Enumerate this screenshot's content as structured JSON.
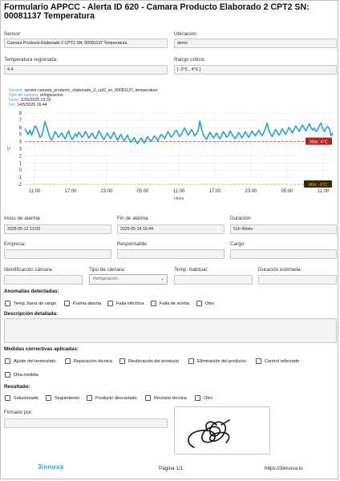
{
  "title": "Formulario APPCC - Alerta ID 620 - Camara Producto Elaborado 2 CPT2 SN: 00081137 Temperatura",
  "sensor": {
    "label": "Sensor:",
    "value": "Camara Producto Elaborado 2 CPT2 SN: 00081137 Temperatura"
  },
  "ubicacion": {
    "label": "Ubicación:",
    "value": "demo"
  },
  "temperatura": {
    "label": "Temperatura registrada:",
    "value": "4.4"
  },
  "rango": {
    "label": "Rango crítico:",
    "value": "[ -2°C , 4°C ]"
  },
  "chart_meta": {
    "sensor_key": "Sensor:",
    "sensor_val": "sensor.camara_producto_elaborado_2_cpt2_sn_00081137_temperature",
    "tipo_key": "Tipo de cámara:",
    "tipo_val": "refrigeracion",
    "inicio_key": "Inicio:",
    "inicio_val": "12/5/2025 13:03",
    "fin_key": "Fin:",
    "fin_val": "14/5/2025 16:44"
  },
  "chart_data": {
    "type": "line",
    "xlabel": "Hora",
    "ylabel": "°C",
    "ylim": [
      -2,
      8
    ],
    "yticks": [
      "8",
      "7",
      "6",
      "5",
      "4",
      "3",
      "2",
      "1",
      "0",
      "-1",
      "-2"
    ],
    "xticks": [
      "11:00",
      "17:00",
      "23:00",
      "05:00",
      "11:00",
      "17:00",
      "23:00",
      "05:00",
      "11:00"
    ],
    "max_label": "Máx: 4°C",
    "min_label": "Mín: -2°C",
    "thresholds": {
      "max": 4,
      "min": -2
    },
    "color": "#2a9fd8",
    "series": [
      {
        "values": [
          5.8,
          5.4,
          5.0,
          5.6,
          4.9,
          5.5,
          6.2,
          5.9,
          5.3,
          4.6,
          4.8,
          5.7,
          6.8,
          6.0,
          5.2,
          4.5,
          4.2,
          4.8,
          5.4,
          5.0,
          4.6,
          4.9,
          5.2,
          4.7,
          4.4,
          5.0,
          5.5,
          4.8,
          4.3,
          4.6,
          5.1,
          4.7,
          5.3,
          5.0,
          4.6,
          4.9,
          5.4,
          5.0,
          4.5,
          4.8,
          5.2,
          4.7,
          4.4,
          4.9,
          5.5,
          5.1,
          4.6,
          4.3,
          4.7,
          5.2,
          4.8,
          4.4,
          4.9,
          5.3,
          4.7,
          4.2,
          4.6,
          5.0,
          4.5,
          4.1,
          4.5,
          4.9,
          4.3,
          3.9,
          4.2,
          4.6,
          4.0,
          3.7,
          4.1,
          4.5,
          4.2,
          3.8,
          4.3,
          4.7,
          4.3,
          4.0,
          4.4,
          4.8,
          4.5,
          4.1,
          4.6,
          5.0,
          4.8,
          4.4,
          4.9,
          5.4,
          5.0,
          4.6,
          4.9,
          5.3,
          5.6,
          5.1,
          4.7,
          5.0,
          5.5,
          5.9,
          5.4,
          4.9,
          5.2,
          5.7,
          5.3,
          4.8,
          5.1,
          5.5,
          6.9,
          5.8,
          5.0,
          4.6,
          4.3,
          4.8,
          5.3,
          4.9,
          4.5,
          4.8,
          5.2,
          4.7,
          4.4,
          4.9,
          5.4,
          5.0,
          4.6,
          4.9,
          5.5,
          5.1,
          4.7,
          4.4,
          4.8,
          5.3,
          4.9,
          4.5,
          4.9,
          5.4,
          5.0,
          4.6,
          5.0,
          5.5,
          5.1,
          4.8,
          5.2,
          5.6,
          5.2,
          4.8,
          5.3,
          5.9,
          6.6,
          5.6,
          5.0,
          4.7,
          5.2,
          5.7,
          5.3,
          4.9,
          5.3,
          5.8,
          5.4,
          5.0,
          5.5,
          6.0,
          5.6,
          5.2,
          5.7,
          6.2,
          5.8,
          5.4,
          5.9,
          6.3,
          5.9,
          5.5,
          6.0,
          6.5,
          6.0,
          5.6,
          5.9,
          5.4,
          5.6,
          6.2,
          6.6,
          5.8,
          5.4,
          5.9,
          6.1,
          5.8,
          4.8,
          5.2
        ]
      }
    ]
  },
  "inicio_alarma": {
    "label": "Inicio de alarma:",
    "value": "2025-05-12 13:03"
  },
  "fin_alarma": {
    "label": "Fin de alarma:",
    "value": "2025-05-14 16:44"
  },
  "duracion": {
    "label": "Duración:",
    "value": "51h 40min"
  },
  "empresa": {
    "label": "Empresa:",
    "value": ""
  },
  "responsable": {
    "label": "Responsable:",
    "value": ""
  },
  "cargo": {
    "label": "Cargo:",
    "value": ""
  },
  "id_camara": {
    "label": "Identificación cámara:",
    "value": ""
  },
  "tipo_camara": {
    "label": "Tipo de cámara:",
    "value": "Refrigeración"
  },
  "temp_habitual": {
    "label": "Temp. habitual:",
    "value": ""
  },
  "duracion_estimada": {
    "label": "Duración estimada:",
    "value": ""
  },
  "anomalias": {
    "label": "Anomalías detectadas:",
    "options": [
      "Temp. fuera de rango",
      "Puerta abierta",
      "Falla eléctrica",
      "Falla de sonda",
      "Otro"
    ]
  },
  "descripcion": {
    "label": "Descripción detallada:",
    "value": ""
  },
  "medidas": {
    "label": "Medidas correctivas aplicadas:",
    "options": [
      "Ajuste del termostato",
      "Reparación técnica",
      "Reubicación del producto",
      "Eliminación del producto",
      "Control reforzado",
      "Otra medida"
    ]
  },
  "resultado": {
    "label": "Resultado:",
    "options": [
      "Solucionado",
      "Seguimiento",
      "Producto descartado",
      "Revisión técnica",
      "Otro"
    ]
  },
  "firmado": {
    "label": "Firmado por:",
    "value": ""
  },
  "footer": {
    "logo": "3innova",
    "page": "Página 1/1",
    "url": "https://3innova.io"
  }
}
